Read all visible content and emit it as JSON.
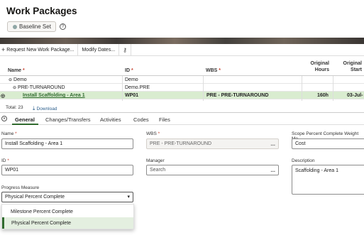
{
  "page": {
    "title": "Work Packages",
    "baseline_label": "Baseline Set",
    "help_icon": "?"
  },
  "toolbar": {
    "request_label": "Request New Work Package...",
    "modify_label": "Modify Dates..."
  },
  "grid": {
    "headers": {
      "name": "Name",
      "id": "ID",
      "wbs": "WBS",
      "req": "*",
      "orig_hours_1": "Original",
      "orig_hours_2": "Hours",
      "orig_start_1": "Original",
      "orig_start_2": "Start"
    },
    "rows": [
      {
        "name": "Demo",
        "id": "Demo",
        "wbs": "",
        "hours": "",
        "start": ""
      },
      {
        "name": "PRE-TURNAROUND",
        "id": "Demo.PRE",
        "wbs": "",
        "hours": "",
        "start": ""
      },
      {
        "name": "Install Scaffolding - Area 1",
        "id": "WP01",
        "wbs": "PRE - PRE-TURNAROUND",
        "hours": "160h",
        "start": "03-Jul-"
      }
    ],
    "total": "Total: 23",
    "download": "Download"
  },
  "tabs": [
    "General",
    "Changes/Transfers",
    "Activities",
    "Codes",
    "Files"
  ],
  "form": {
    "name_label": "Name",
    "name_value": "Install Scaffolding - Area 1",
    "wbs_label": "WBS",
    "wbs_value": "PRE - PRE-TURNAROUND",
    "scope_label": "Scope Percent Complete Weight Me",
    "scope_value": "Cost",
    "id_label": "ID",
    "id_value": "WP01",
    "manager_label": "Manager",
    "manager_placeholder": "Search",
    "desc_label": "Description",
    "desc_value": "Scaffolding - Area 1",
    "progress_label": "Progress Measure",
    "progress_value": "Physical Percent Complete",
    "required_marker": "*",
    "ellipsis": "..."
  },
  "dropdown": {
    "options": [
      "Milestone Percent Complete",
      "Physical Percent Complete"
    ],
    "selected_index": 1
  },
  "colors": {
    "accent": "#316b2f",
    "selected_row": "#d9ecd0",
    "required": "#c74634"
  }
}
